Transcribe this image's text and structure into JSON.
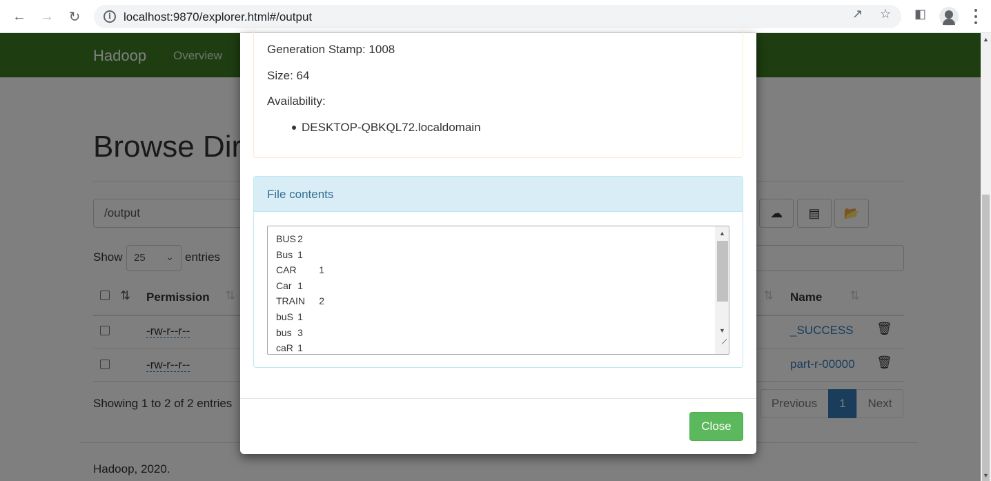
{
  "browser": {
    "url": "localhost:9870/explorer.html#/output"
  },
  "navbar": {
    "brand": "Hadoop",
    "overview": "Overview"
  },
  "page": {
    "title": "Browse Directory",
    "path_value": "/output",
    "show_label": "Show",
    "entries_value": "25",
    "entries_label": "entries",
    "columns": {
      "permission": "Permission",
      "name": "Name"
    },
    "rows": [
      {
        "permission": "-rw-r--r--",
        "name": "_SUCCESS"
      },
      {
        "permission": "-rw-r--r--",
        "name": "part-r-00000"
      }
    ],
    "showing": "Showing 1 to 2 of 2 entries",
    "pager": {
      "previous": "Previous",
      "current": "1",
      "next": "Next"
    },
    "footer": "Hadoop, 2020."
  },
  "modal": {
    "generation_stamp": "Generation Stamp: 1008",
    "size": "Size: 64",
    "availability_label": "Availability:",
    "availability_host": "DESKTOP-QBKQL72.localdomain",
    "contents_title": "File contents",
    "file_lines": [
      "BUS\t2",
      "Bus\t1",
      "CAR\t1",
      "Car\t1",
      "TRAIN\t2",
      "buS\t1",
      "bus\t3",
      "caR\t1"
    ],
    "close_label": "Close"
  },
  "colors": {
    "navbar": "#3c7a22",
    "close_button": "#5cb85c",
    "panel_heading": "#d9edf7",
    "link": "#337ab7"
  }
}
